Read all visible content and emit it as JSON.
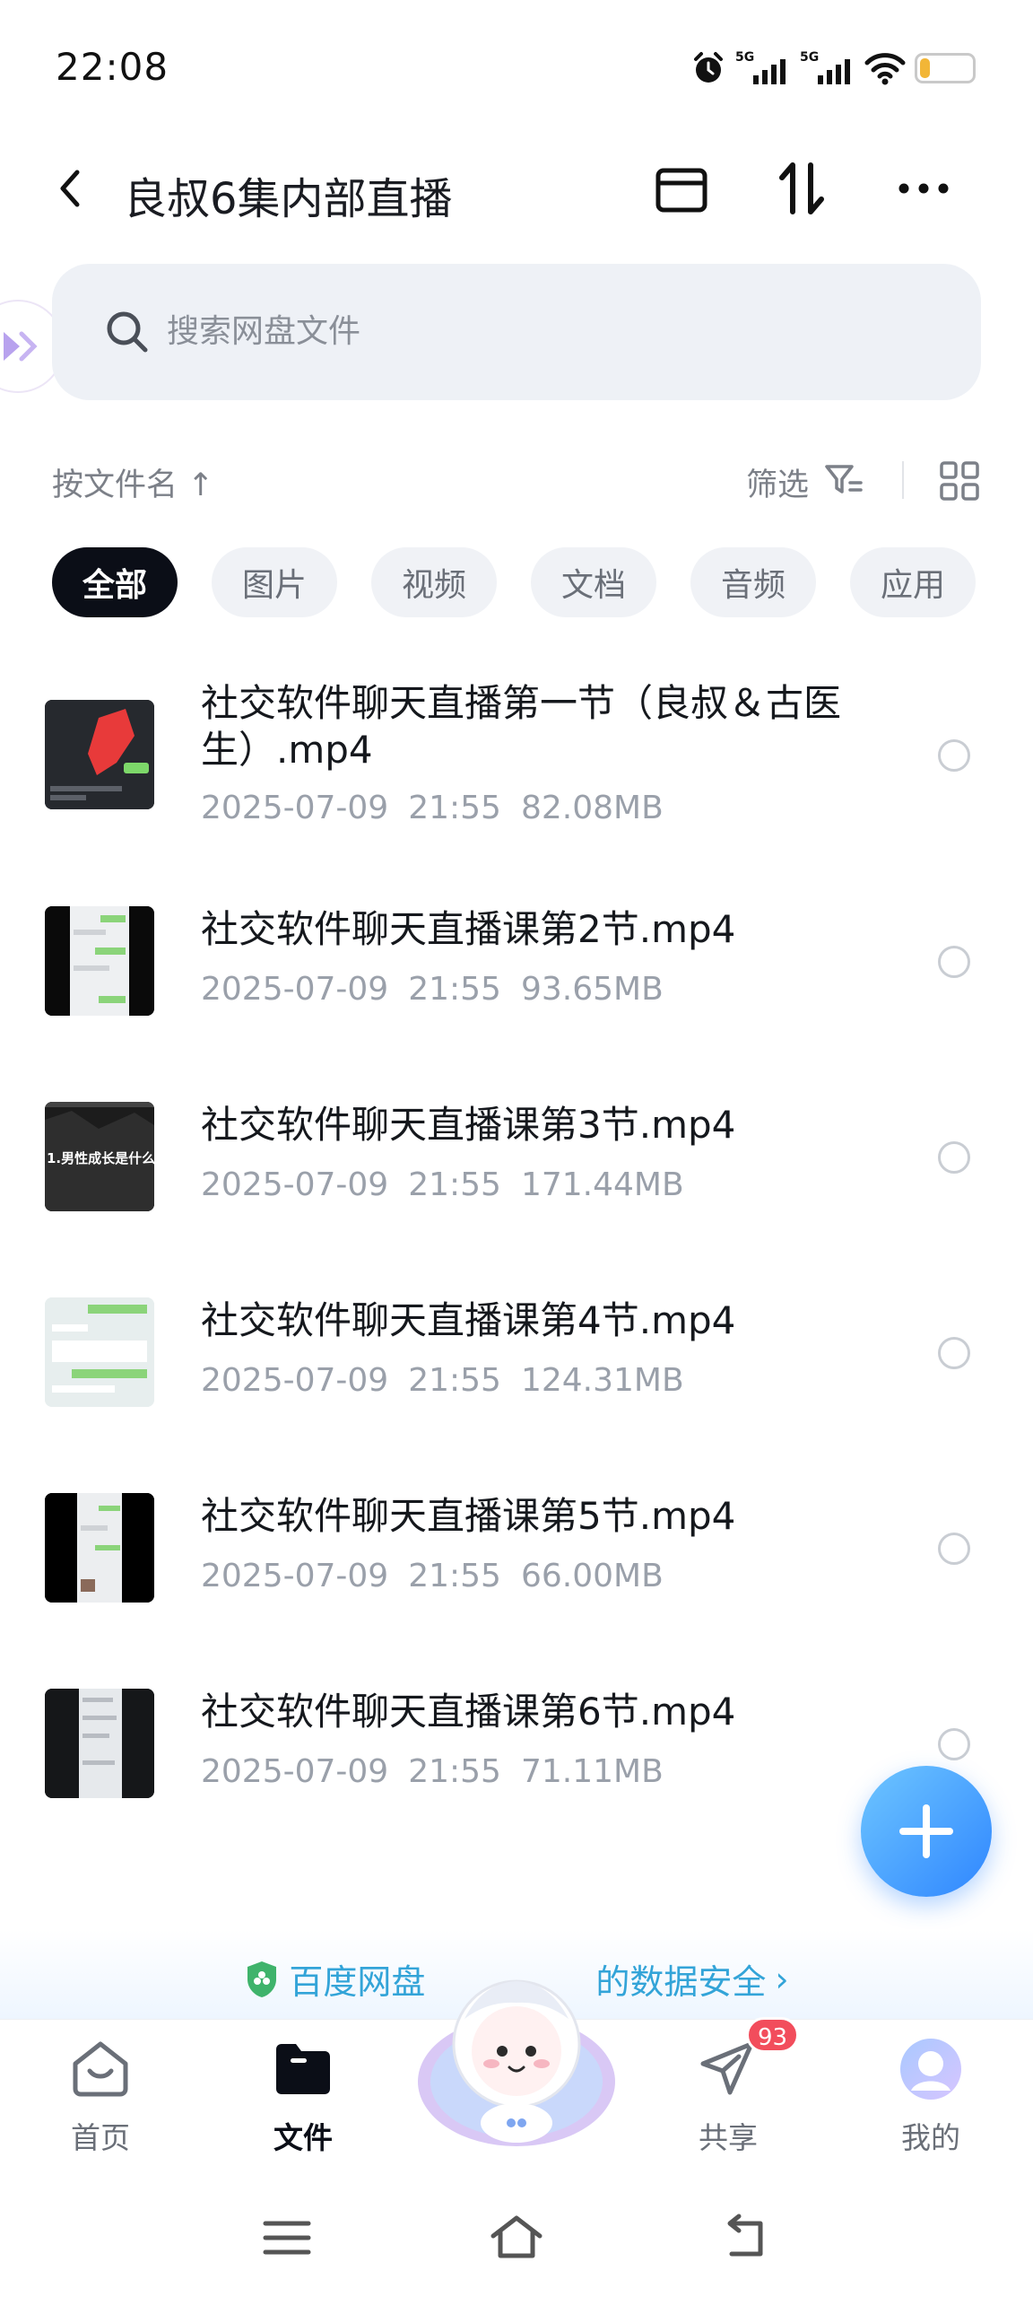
{
  "status_bar": {
    "time": "22:08",
    "network_5g_1": "5G",
    "network_5g_2": "5G",
    "battery": "27",
    "battery_percent": 27
  },
  "header": {
    "title": "良叔6集内部直播",
    "icons": [
      "back-arrow-icon",
      "archive-icon",
      "sort-icon",
      "more-icon"
    ]
  },
  "search": {
    "placeholder": "搜索网盘文件"
  },
  "sort": {
    "label": "按文件名 ↑",
    "filter_label": "筛选"
  },
  "filters": [
    "全部",
    "图片",
    "视频",
    "文档",
    "音频",
    "应用"
  ],
  "files": [
    {
      "name": "社交软件聊天直播第一节（良叔＆古医生）.mp4",
      "date": "2025-07-09",
      "time": "21:55",
      "size": "82.08MB"
    },
    {
      "name": "社交软件聊天直播课第2节.mp4",
      "date": "2025-07-09",
      "time": "21:55",
      "size": "93.65MB"
    },
    {
      "name": "社交软件聊天直播课第3节.mp4",
      "date": "2025-07-09",
      "time": "21:55",
      "size": "171.44MB",
      "thumb_caption": "1.男性成长是什么"
    },
    {
      "name": "社交软件聊天直播课第4节.mp4",
      "date": "2025-07-09",
      "time": "21:55",
      "size": "124.31MB"
    },
    {
      "name": "社交软件聊天直播课第5节.mp4",
      "date": "2025-07-09",
      "time": "21:55",
      "size": "66.00MB"
    },
    {
      "name": "社交软件聊天直播课第6节.mp4",
      "date": "2025-07-09",
      "time": "21:55",
      "size": "71.11MB"
    }
  ],
  "banner": {
    "text_left": "百度网盘",
    "text_right": "的数据安全",
    "chevron": "›"
  },
  "tabs": [
    {
      "label": "首页",
      "icon": "home-icon"
    },
    {
      "label": "文件",
      "icon": "folder-icon"
    },
    {
      "label": "共享",
      "icon": "paper-plane-icon"
    },
    {
      "label": "我的",
      "icon": "profile-icon"
    }
  ],
  "share_badge": "93",
  "colors": {
    "accent": "#2f86ff",
    "active_chip": "#0b0e17",
    "badge": "#f24d5c",
    "security_text": "#33a4d8",
    "battery": "#f2b637"
  }
}
